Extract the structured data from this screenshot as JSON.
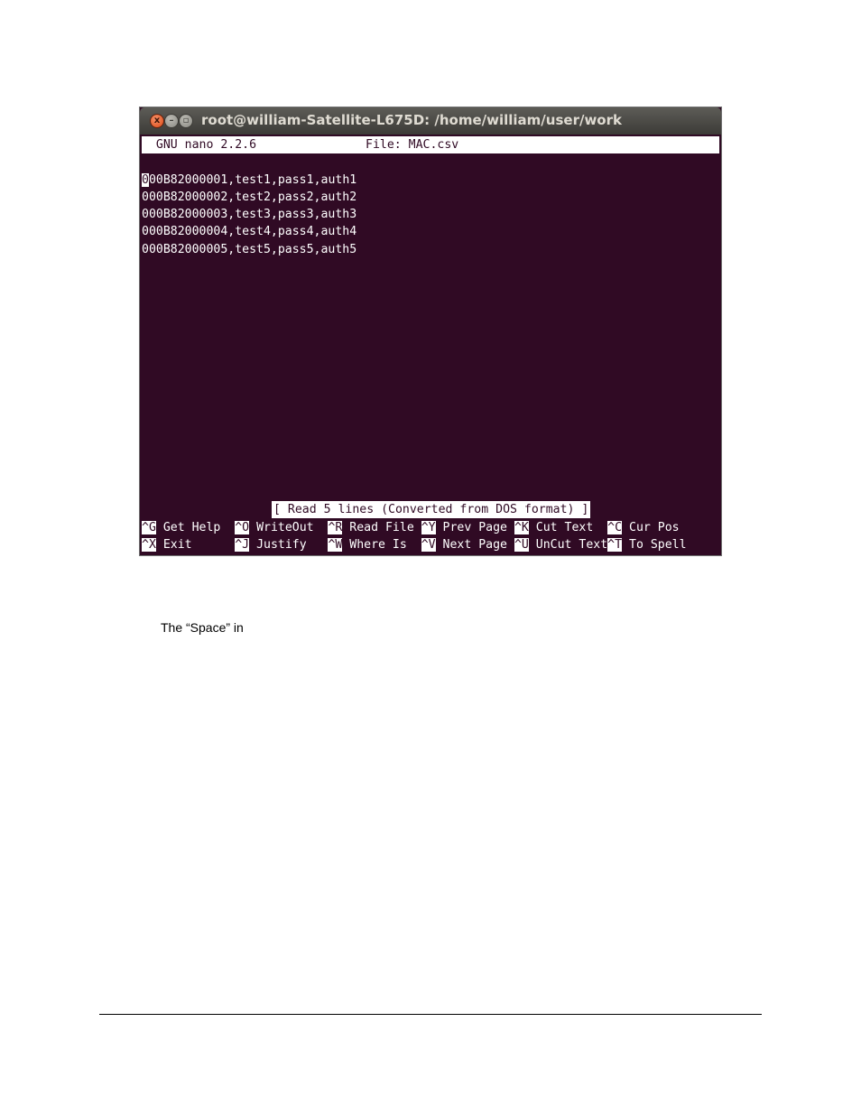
{
  "window": {
    "title": "root@william-Satellite-L675D: /home/william/user/work",
    "close_glyph": "x",
    "min_glyph": "–",
    "max_glyph": "▫"
  },
  "nano": {
    "header_left": "  GNU nano 2.2.6",
    "header_file": "File: MAC.csv",
    "cursor_char": "0",
    "lines": [
      "00B82000001,test1,pass1,auth1",
      "000B82000002,test2,pass2,auth2",
      "000B82000003,test3,pass3,auth3",
      "000B82000004,test4,pass4,auth4",
      "000B82000005,test5,pass5,auth5"
    ],
    "status": "[ Read 5 lines (Converted from DOS format) ]",
    "shortcuts_row1": [
      {
        "key": "^G",
        "label": " Get Help  "
      },
      {
        "key": "^O",
        "label": " WriteOut  "
      },
      {
        "key": "^R",
        "label": " Read File "
      },
      {
        "key": "^Y",
        "label": " Prev Page "
      },
      {
        "key": "^K",
        "label": " Cut Text  "
      },
      {
        "key": "^C",
        "label": " Cur Pos"
      }
    ],
    "shortcuts_row2": [
      {
        "key": "^X",
        "label": " Exit      "
      },
      {
        "key": "^J",
        "label": " Justify   "
      },
      {
        "key": "^W",
        "label": " Where Is  "
      },
      {
        "key": "^V",
        "label": " Next Page "
      },
      {
        "key": "^U",
        "label": " UnCut Text"
      },
      {
        "key": "^T",
        "label": " To Spell"
      }
    ]
  },
  "page": {
    "caption": "The “Space” in"
  }
}
